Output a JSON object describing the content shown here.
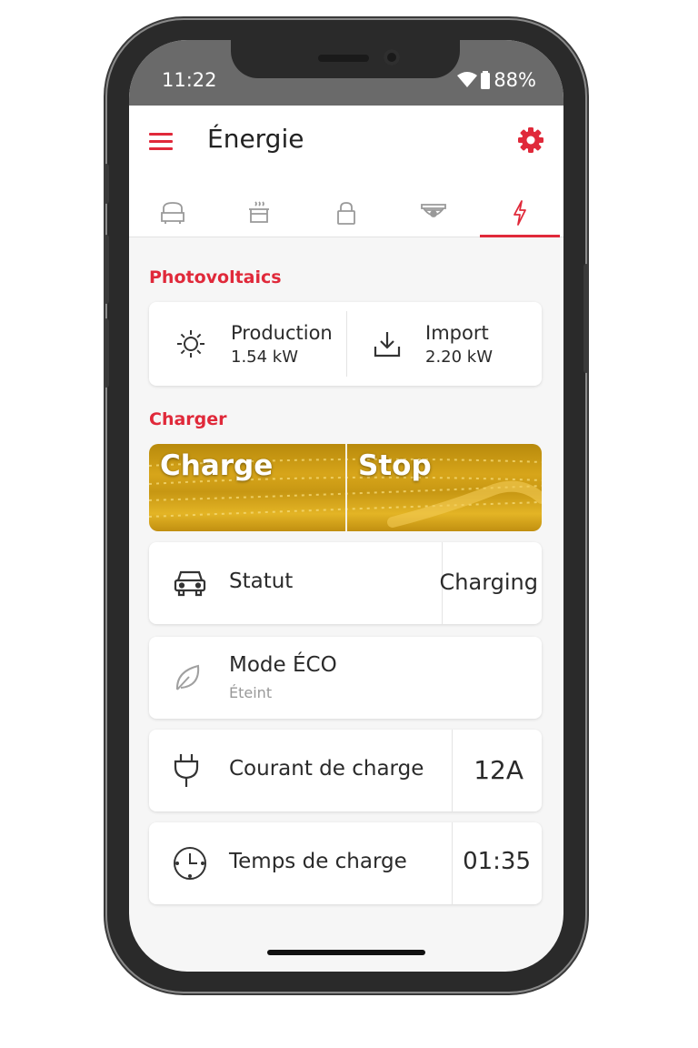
{
  "status_bar": {
    "time": "11:22",
    "battery": "88%"
  },
  "header": {
    "title": "Énergie"
  },
  "tabs": [
    {
      "icon": "sofa-icon",
      "active": false
    },
    {
      "icon": "cooking-pot-icon",
      "active": false
    },
    {
      "icon": "lock-icon",
      "active": false
    },
    {
      "icon": "security-camera-icon",
      "active": false
    },
    {
      "icon": "lightning-icon",
      "active": true
    }
  ],
  "photovoltaics": {
    "section_label": "Photovoltaics",
    "production": {
      "label": "Production",
      "value": "1.54 kW",
      "icon": "sun-icon"
    },
    "import": {
      "label": "Import",
      "value": "2.20 kW",
      "icon": "download-icon"
    }
  },
  "charger": {
    "section_label": "Charger",
    "charge_label": "Charge",
    "stop_label": "Stop",
    "status": {
      "label": "Statut",
      "value": "Charging",
      "icon": "car-icon"
    },
    "eco_mode": {
      "label": "Mode ÉCO",
      "sub": "Éteint",
      "icon": "leaf-icon"
    },
    "current": {
      "label": "Courant de charge",
      "value": "12A",
      "icon": "plug-icon"
    },
    "duration": {
      "label": "Temps de charge",
      "value": "01:35",
      "icon": "clock-icon"
    }
  },
  "colors": {
    "accent": "#e0293a",
    "gold": "#d7a51a"
  }
}
